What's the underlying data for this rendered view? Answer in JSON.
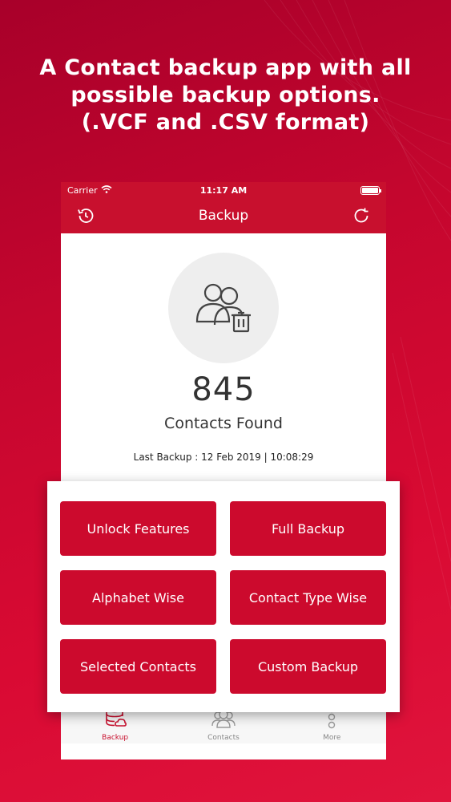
{
  "headline": {
    "line1": "A Contact backup app with all",
    "line2": "possible backup options.",
    "line3": "(.VCF and .CSV format)"
  },
  "status_bar": {
    "carrier": "Carrier",
    "time": "11:17 AM"
  },
  "nav": {
    "title": "Backup",
    "left_icon": "history-icon",
    "right_icon": "refresh-icon"
  },
  "summary": {
    "count": "845",
    "count_label": "Contacts Found",
    "last_backup": "Last Backup : 12 Feb 2019 | 10:08:29"
  },
  "actions": {
    "unlock_features": "Unlock Features",
    "full_backup": "Full Backup",
    "alphabet_wise": "Alphabet Wise",
    "contact_type_wise": "Contact Type Wise",
    "selected_contacts": "Selected Contacts",
    "custom_backup": "Custom Backup"
  },
  "tabs": {
    "backup": "Backup",
    "contacts": "Contacts",
    "more": "More"
  },
  "colors": {
    "brand_red": "#c8102e",
    "button_red": "#cc0a2d"
  }
}
